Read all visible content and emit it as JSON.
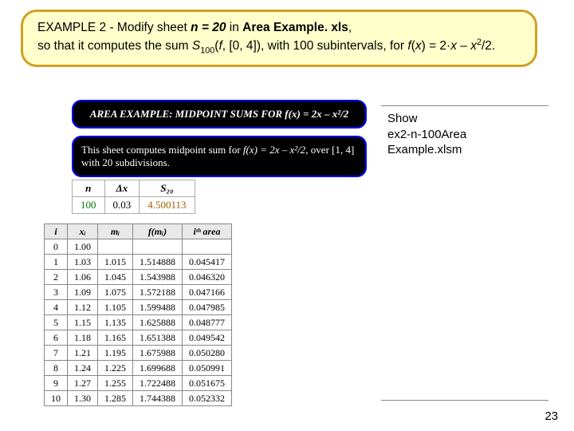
{
  "topbox": {
    "line1_prefix": "EXAMPLE 2 -  Modify sheet ",
    "sheetname": "n = 20",
    "line1_mid": " in ",
    "filename": "Area Example. xls",
    "line1_end": ",",
    "line2_a": "so that it computes the sum ",
    "line2_S": "S",
    "line2_sub": "100",
    "line2_b": "(",
    "line2_f": "f",
    "line2_c": ", [0, 4]), with 100 subintervals, for ",
    "line2_fx": "f",
    "line2_d": "(",
    "line2_x": "x",
    "line2_e": ") = 2·",
    "line2_x2": "x",
    "line2_g": " – ",
    "line3_x": "x",
    "line3_sup": "2",
    "line3_end": "/2."
  },
  "blackbox1": "AREA EXAMPLE:  MIDPOINT SUMS FOR f(x) = 2x – x²/2",
  "blackbox2": {
    "a": "This sheet computes midpoint sum for ",
    "b": "f(x) = 2x – x²/2",
    "c": ", over [1, 4] with 20 subdivisions."
  },
  "summary": {
    "headers": [
      "n",
      "Δx",
      "S₂₀"
    ],
    "n": "100",
    "dx": "0.03",
    "s20": "4.500113"
  },
  "datatable": {
    "headers": [
      "i",
      "xᵢ",
      "mᵢ",
      "f(mᵢ)",
      "iᵗʰ area"
    ],
    "rows": [
      [
        "0",
        "1.00",
        "",
        "",
        ""
      ],
      [
        "1",
        "1.03",
        "1.015",
        "1.514888",
        "0.045417"
      ],
      [
        "2",
        "1.06",
        "1.045",
        "1.543988",
        "0.046320"
      ],
      [
        "3",
        "1.09",
        "1.075",
        "1.572188",
        "0.047166"
      ],
      [
        "4",
        "1.12",
        "1.105",
        "1.599488",
        "0.047985"
      ],
      [
        "5",
        "1.15",
        "1.135",
        "1.625888",
        "0.048777"
      ],
      [
        "6",
        "1.18",
        "1.165",
        "1.651388",
        "0.049542"
      ],
      [
        "7",
        "1.21",
        "1.195",
        "1.675988",
        "0.050280"
      ],
      [
        "8",
        "1.24",
        "1.225",
        "1.699688",
        "0.050991"
      ],
      [
        "9",
        "1.27",
        "1.255",
        "1.722488",
        "0.051675"
      ],
      [
        "10",
        "1.30",
        "1.285",
        "1.744388",
        "0.052332"
      ]
    ]
  },
  "sidebox": {
    "line1": "Show",
    "line2": "ex2-n-100Area Example.xlsm"
  },
  "pagenum": "23"
}
